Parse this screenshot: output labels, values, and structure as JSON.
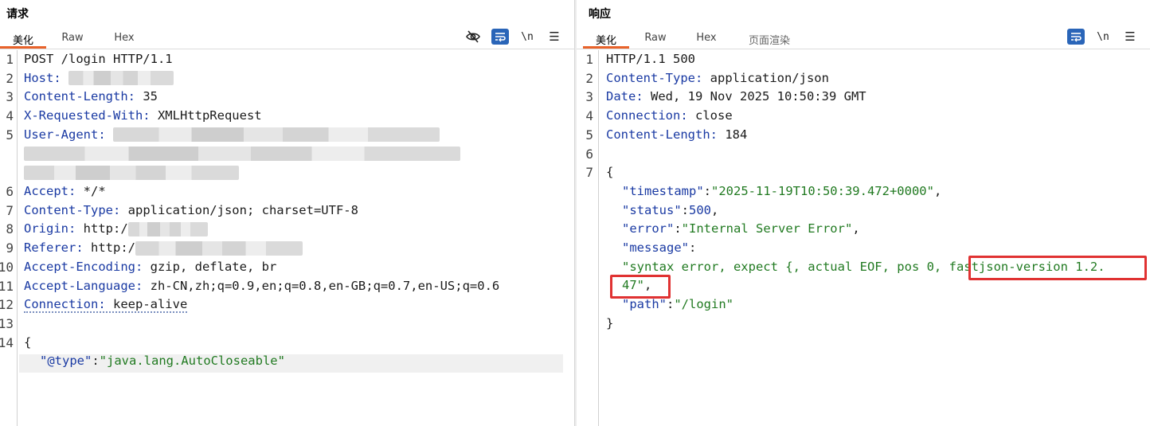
{
  "request": {
    "title": "请求",
    "tabs": [
      "美化",
      "Raw",
      "Hex"
    ],
    "active_tab": "美化",
    "toolbar": {
      "hide_icon": "eye-slash-icon",
      "wrap_icon": "word-wrap-icon",
      "newline_label": "\\n",
      "menu_icon": "hamburger-menu-icon"
    },
    "line_numbers": [
      "1",
      "2",
      "3",
      "4",
      "5",
      "6",
      "7",
      "8",
      "9",
      "10",
      "11",
      "12",
      "13",
      "14"
    ],
    "lines": {
      "l1": "POST /login HTTP/1.1",
      "l2_key": "Host:",
      "l3_key": "Content-Length:",
      "l3_val": " 35",
      "l4_key": "X-Requested-With:",
      "l4_val": " XMLHttpRequest",
      "l5_key": "User-Agent:",
      "l6_key": "Accept:",
      "l6_val": " */*",
      "l7_key": "Content-Type:",
      "l7_val": " application/json; charset=UTF-8",
      "l8_key": "Origin:",
      "l8_val": " http:/",
      "l9_key": "Referer:",
      "l9_val": " http:/",
      "l10_key": "Accept-Encoding:",
      "l10_val": " gzip, deflate, br",
      "l11_key": "Accept-Language:",
      "l11_val": " zh-CN,zh;q=0.9,en;q=0.8,en-GB;q=0.7,en-US;q=0.6",
      "l12_key": "Connection:",
      "l12_val": " keep-alive",
      "l14_brace": "{",
      "body_key": "\"@type\"",
      "body_colon": ":",
      "body_val": "\"java.lang.AutoCloseable\""
    }
  },
  "response": {
    "title": "响应",
    "tabs": [
      "美化",
      "Raw",
      "Hex",
      "页面渲染"
    ],
    "active_tab": "美化",
    "toolbar": {
      "wrap_icon": "word-wrap-icon",
      "newline_label": "\\n",
      "menu_icon": "hamburger-menu-icon"
    },
    "line_numbers": [
      "1",
      "2",
      "3",
      "4",
      "5",
      "6",
      "7"
    ],
    "lines": {
      "l1": "HTTP/1.1 500",
      "l2_key": "Content-Type:",
      "l2_val": " application/json",
      "l3_key": "Date:",
      "l3_val": " Wed, 19 Nov 2025 10:50:39 GMT",
      "l4_key": "Connection:",
      "l4_val": " close",
      "l5_key": "Content-Length:",
      "l5_val": " 184",
      "open_brace": "{",
      "ts_key": "\"timestamp\"",
      "ts_val": "\"2025-11-19T10:50:39.472+0000\"",
      "status_key": "\"status\"",
      "status_val": "500",
      "error_key": "\"error\"",
      "error_val": "\"Internal Server Error\"",
      "message_key": "\"message\"",
      "message_val_a": "\"syntax error, expect {, actual EOF, pos 0, ",
      "message_val_b": "fastjson-version 1.2.",
      "message_val_c": "47\"",
      "path_key": "\"path\"",
      "path_val": "\"/login\"",
      "close_brace": "}",
      "colon": ":",
      "comma": ","
    }
  },
  "colors": {
    "accent_tab": "#e8622a",
    "highlight_box": "#e03232",
    "header_key": "#1a3aa3",
    "json_string": "#217a21"
  }
}
